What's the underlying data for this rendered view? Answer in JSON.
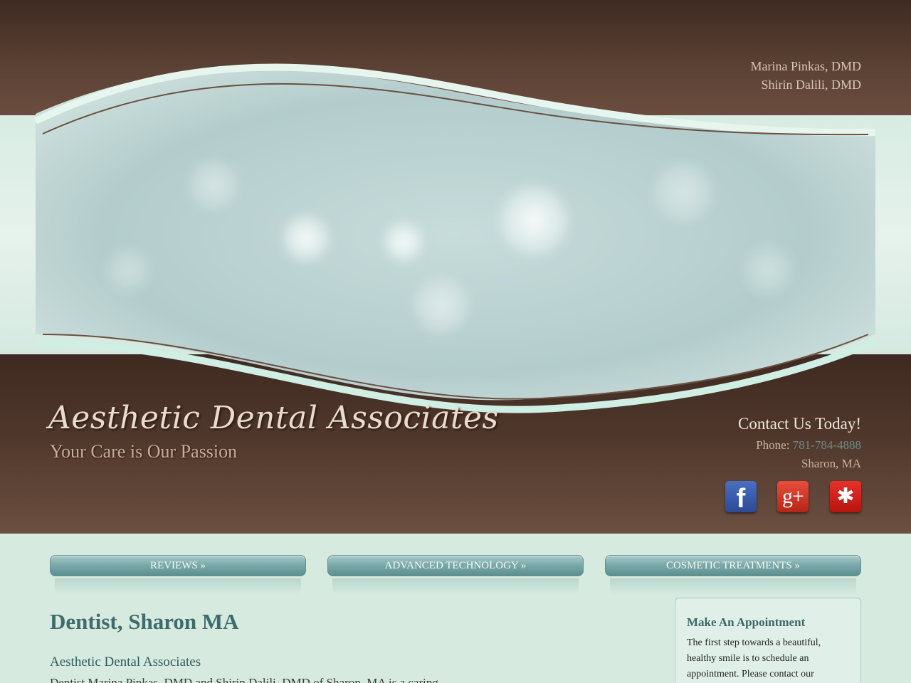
{
  "header": {
    "doctors": [
      "Marina Pinkas, DMD",
      "Shirin Dalili, DMD"
    ],
    "brand_name": "Aesthetic Dental Associates",
    "tagline": "Your Care is Our Passion"
  },
  "contact": {
    "title": "Contact Us Today!",
    "phone_label": "Phone:",
    "phone": "781-784-4888",
    "location": "Sharon, MA"
  },
  "social": [
    {
      "name": "facebook-icon",
      "glyph": "f"
    },
    {
      "name": "google-plus-icon",
      "glyph": "g+"
    },
    {
      "name": "yelp-icon",
      "glyph": "✱"
    }
  ],
  "nav": [
    "REVIEWS »",
    "ADVANCED TECHNOLOGY »",
    "COSMETIC TREATMENTS »"
  ],
  "main": {
    "title": "Dentist, Sharon MA",
    "practice": "Aesthetic Dental Associates",
    "partial_line": "Dentist Marina Pinkas, DMD and Shirin Dalili, DMD of Sharon, MA is a caring"
  },
  "appointment": {
    "title": "Make An Appointment",
    "text": "The first step towards a beautiful, healthy smile is to schedule an appointment. Please contact our"
  },
  "colors": {
    "brown": "#4f372b",
    "mint": "#d6eadf",
    "teal_button": "#7caaaa"
  }
}
